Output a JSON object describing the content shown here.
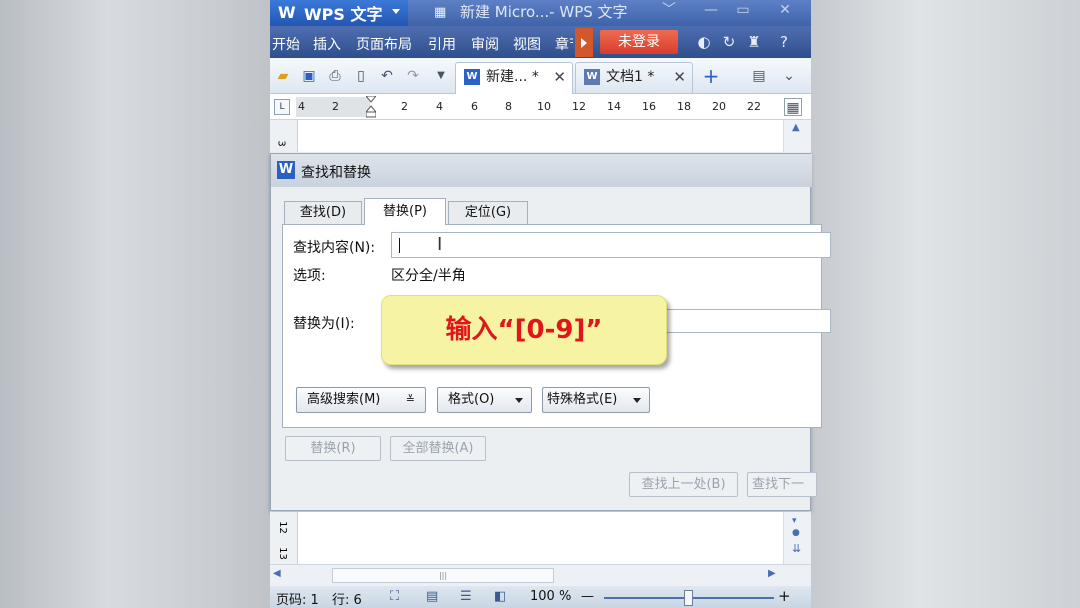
{
  "app": {
    "product": "WPS 文字",
    "window_title": "新建 Micro...- WPS 文字",
    "window_controls": [
      "﹀",
      "—",
      "▭",
      "✕"
    ]
  },
  "menu": {
    "items": [
      "开始",
      "插入",
      "页面布局",
      "引用",
      "审阅",
      "视图",
      "章节"
    ],
    "login_label": "未登录",
    "right_icons": [
      "skin-icon",
      "refresh-icon",
      "shirt-icon",
      "help-icon"
    ],
    "help_label": "?"
  },
  "toolbar": {
    "icons": [
      "open-icon",
      "save-icon",
      "print-icon",
      "print-preview-icon",
      "undo-icon",
      "redo-icon",
      "dropdown-icon"
    ],
    "tabs": [
      {
        "label": "新建...",
        "modified": "*",
        "active": true
      },
      {
        "label": "文档1",
        "modified": "*",
        "active": false
      }
    ],
    "new_tab_label": "+"
  },
  "ruler": {
    "corner_label": "L",
    "left_numbers": [
      "4",
      "2"
    ],
    "numbers": [
      "2",
      "4",
      "6",
      "8",
      "10",
      "12",
      "14",
      "16",
      "18",
      "20",
      "22"
    ]
  },
  "vruler": {
    "top_number": "3",
    "bottom_numbers": [
      "12",
      "13"
    ]
  },
  "dialog": {
    "title": "查找和替换",
    "tabs": [
      "查找(D)",
      "替换(P)",
      "定位(G)"
    ],
    "active_tab": "替换(P)",
    "find_label": "查找内容(N):",
    "find_value": "",
    "options_label": "选项:",
    "options_value": "区分全/半角",
    "replace_label": "替换为(I):",
    "replace_value": "",
    "advanced_search": "高级搜索(M)",
    "format": "格式(O)",
    "special_format": "特殊格式(E)",
    "replace_button": "替换(R)",
    "replace_all_button": "全部替换(A)",
    "find_prev_button": "查找上一处(B)",
    "find_next_button": "查找下一"
  },
  "callout": {
    "text": "输入“[0-9]”",
    "color": "#e0161a"
  },
  "statusbar": {
    "page": "页码: 1",
    "line": "行: 6",
    "zoom": "100 %",
    "zoom_minus": "—",
    "zoom_plus": "+",
    "zoom_level": 0.5
  },
  "scroll": {
    "hthumb_grip": "|||"
  }
}
